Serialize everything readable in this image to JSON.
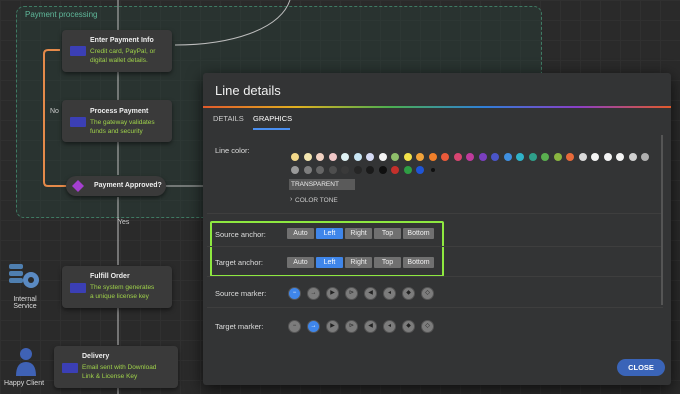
{
  "diagram": {
    "swimlane_label": "Payment processing",
    "nodes": [
      {
        "title": "Enter Payment Info",
        "desc": [
          "Credit card, PayPal, or",
          "digital wallet details."
        ]
      },
      {
        "title": "Process Payment",
        "desc": [
          "The gateway validates",
          "funds and security"
        ]
      },
      {
        "title": "Payment Approved?",
        "desc": []
      },
      {
        "title": "Fulfill Order",
        "desc": [
          "The system generates",
          "a unique license key"
        ]
      },
      {
        "title": "Delivery",
        "desc": [
          "Email sent with Download",
          "Link & License Key"
        ]
      }
    ],
    "wire_labels": {
      "no": "No",
      "yes": "Yes"
    },
    "actors": {
      "internal": [
        "Internal",
        "Service"
      ],
      "client": "Happy Client"
    }
  },
  "dialog": {
    "title": "Line details",
    "tabs": [
      {
        "label": "DETAILS"
      },
      {
        "label": "GRAPHICS",
        "active": true
      }
    ],
    "line_color_label": "Line color:",
    "palette_row1": [
      "#f3d98a",
      "#f3e6b0",
      "#f2d2c2",
      "#f0c7c7",
      "#dff1f4",
      "#c9e6f5",
      "#d6dbf5",
      "#f4f4f4",
      "#8fbf6a",
      "#f2e24a",
      "#f2a33a",
      "#f07f2a",
      "#ea5a3a",
      "#d84570",
      "#bf3b9c",
      "#7a3fbf",
      "#4a55c8",
      "#3f8fe0",
      "#2fb2c8",
      "#2f9f8a",
      "#5aaf4f",
      "#8ab540",
      "#e86a3a",
      "#d9d9d9",
      "#f4f4f4",
      "#f4f4f4",
      "#f4f4f4",
      "#d0d0d0",
      "#b0b0b0"
    ],
    "palette_row2": [
      "#9a9a9a",
      "#7e7e7e",
      "#666666",
      "#4e4e4e",
      "#3a3a3a",
      "#262626",
      "#1a1a1a",
      "#0f0f0f",
      "#c4302b",
      "#2f9e44",
      "#1f55d6",
      "#101010"
    ],
    "transparent_label": "TRANSPARENT",
    "color_tone_label": "COLOR TONE",
    "source_anchor_label": "Source anchor:",
    "target_anchor_label": "Target anchor:",
    "anchor_options": [
      "Auto",
      "Left",
      "Right",
      "Top",
      "Bottom"
    ],
    "source_anchor_selected": "Left",
    "target_anchor_selected": "Left",
    "source_marker_label": "Source marker:",
    "target_marker_label": "Target marker:",
    "marker_glyphs": [
      "−",
      "→",
      "▶",
      "⊳",
      "◀",
      "◂",
      "◆",
      "◇"
    ],
    "source_marker_selected": 0,
    "target_marker_selected": 1,
    "close_label": "CLOSE"
  }
}
